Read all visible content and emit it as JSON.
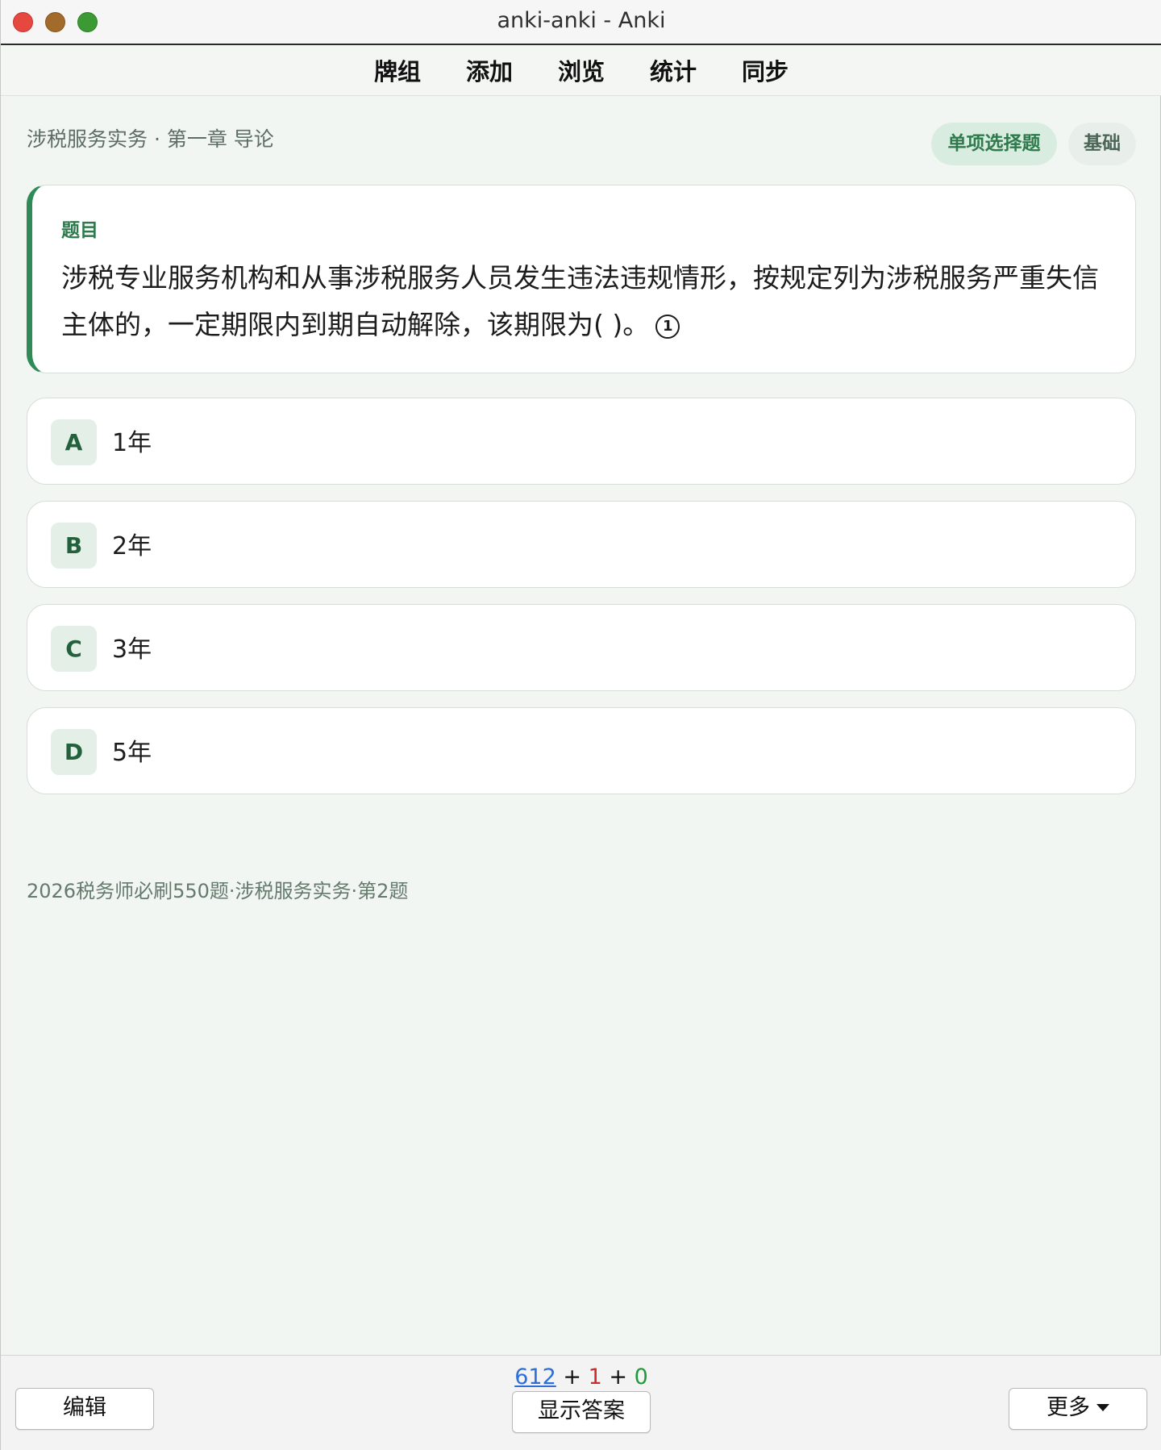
{
  "window": {
    "title": "anki-anki - Anki"
  },
  "nav": {
    "items": [
      "牌组",
      "添加",
      "浏览",
      "统计",
      "同步"
    ]
  },
  "card": {
    "breadcrumb": "涉税服务实务 · 第一章 导论",
    "tags": {
      "type": "单项选择题",
      "level": "基础"
    },
    "question_label": "题目",
    "question_text": "涉税专业服务机构和从事涉税服务人员发生违法违规情形，按规定列为涉税服务严重失信主体的，一定期限内到期自动解除，该期限为( )。",
    "question_marker": "1",
    "options": [
      {
        "letter": "A",
        "text": "1年"
      },
      {
        "letter": "B",
        "text": "2年"
      },
      {
        "letter": "C",
        "text": "3年"
      },
      {
        "letter": "D",
        "text": "5年"
      }
    ],
    "source": "2026税务师必刷550题·涉税服务实务·第2题"
  },
  "footer": {
    "counts": {
      "new": "612",
      "learning": "1",
      "review": "0",
      "sep": "+"
    },
    "edit_label": "编辑",
    "show_answer_label": "显示答案",
    "more_label": "更多"
  },
  "colors": {
    "accent": "#2e8a57",
    "new_count": "#2d6fd6",
    "learning_count": "#d12a2a",
    "review_count": "#1f9a3a"
  },
  "icons": {
    "close": "close-icon",
    "minimize": "minimize-icon",
    "maximize": "maximize-icon",
    "more_caret": "chevron-down-icon"
  }
}
